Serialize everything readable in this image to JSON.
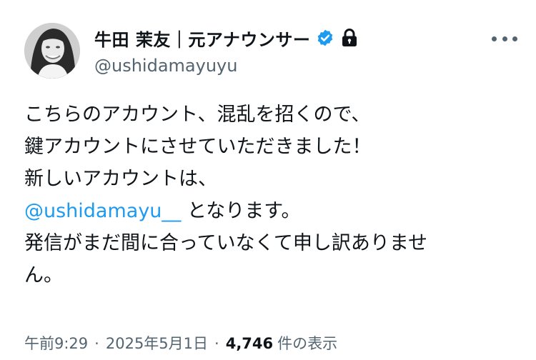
{
  "author": {
    "display_name": "牛田 茉友｜元アナウンサー",
    "handle": "@ushidamayuyu",
    "verified": true,
    "protected": true,
    "avatar_icon": "avatar-photo-icon",
    "verified_icon": "verified-badge-icon",
    "lock_icon": "lock-icon",
    "verified_color": "#1d9bf0"
  },
  "more_icon": "more-options-icon",
  "tweet": {
    "lines": [
      "こちらのアカウント、混乱を招くので、",
      "鍵アカウントにさせていただきました！",
      "新しいアカウントは、"
    ],
    "mention": "@ushidamayu__",
    "mention_suffix": " となります。",
    "lines_after": [
      "発信がまだ間に合っていなくて申し訳ありませ",
      "ん。"
    ],
    "link_color": "#1d9bf0"
  },
  "meta": {
    "time": "午前9:29",
    "date": "2025年5月1日",
    "separator": "·",
    "views_count": "4,746",
    "views_label": "件の表示"
  }
}
